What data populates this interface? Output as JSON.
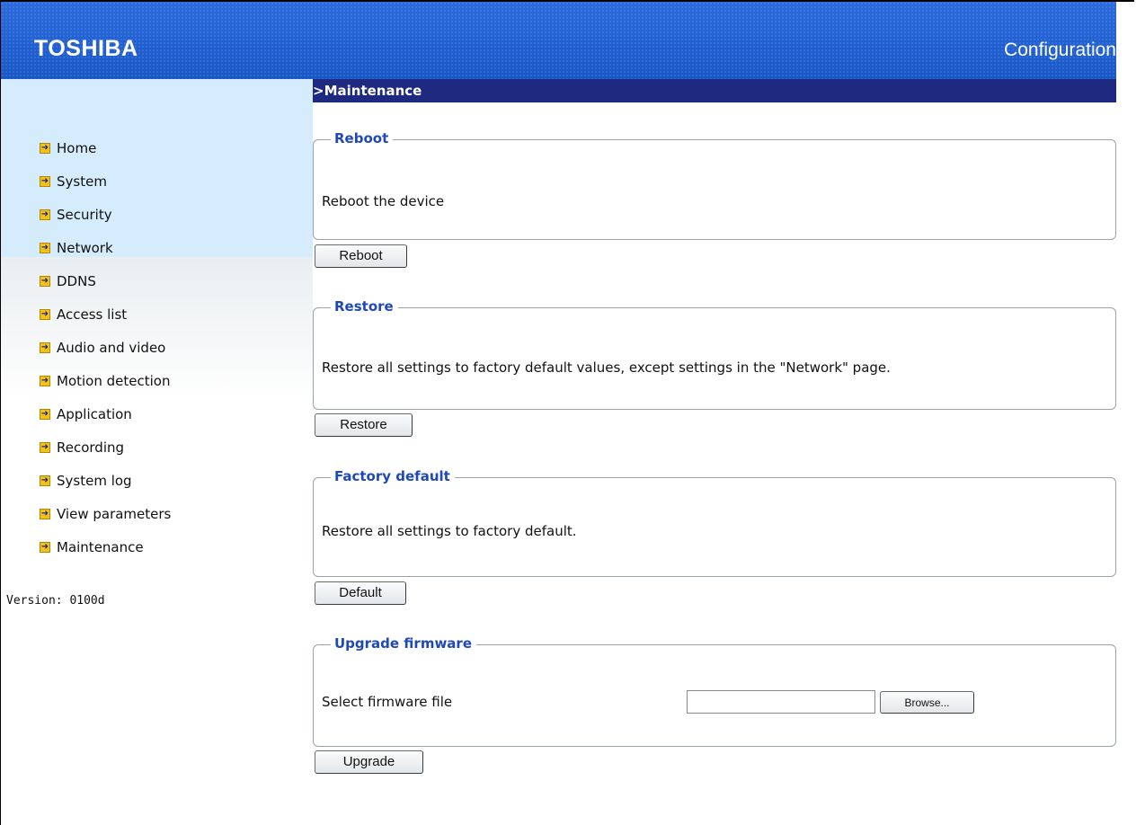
{
  "header": {
    "brand": "TOSHIBA",
    "title": "Configuration"
  },
  "breadcrumb": ">Maintenance",
  "sidebar": {
    "items": [
      {
        "label": "Home"
      },
      {
        "label": "System"
      },
      {
        "label": "Security"
      },
      {
        "label": "Network"
      },
      {
        "label": "DDNS"
      },
      {
        "label": "Access list"
      },
      {
        "label": "Audio and video"
      },
      {
        "label": "Motion detection"
      },
      {
        "label": "Application"
      },
      {
        "label": "Recording"
      },
      {
        "label": "System log"
      },
      {
        "label": "View parameters"
      },
      {
        "label": "Maintenance"
      }
    ],
    "version": "Version: 0100d"
  },
  "sections": {
    "reboot": {
      "legend": "Reboot",
      "description": "Reboot the device",
      "button": "Reboot"
    },
    "restore": {
      "legend": "Restore",
      "description": "Restore all settings to factory default values, except settings in the \"Network\" page.",
      "button": "Restore"
    },
    "factory_default": {
      "legend": "Factory default",
      "description": "Restore all settings to factory default.",
      "button": "Default"
    },
    "upgrade": {
      "legend": "Upgrade firmware",
      "label": "Select firmware file",
      "file_value": "",
      "browse_button": "Browse...",
      "button": "Upgrade"
    }
  },
  "colors": {
    "header_blue": "#1e5fd0",
    "breadcrumb_navy": "#1d2a80",
    "sidebar_light_blue": "#d4ecfc",
    "legend_blue": "#1f49b8",
    "nav_arrow_yellow": "#f2c21a"
  }
}
